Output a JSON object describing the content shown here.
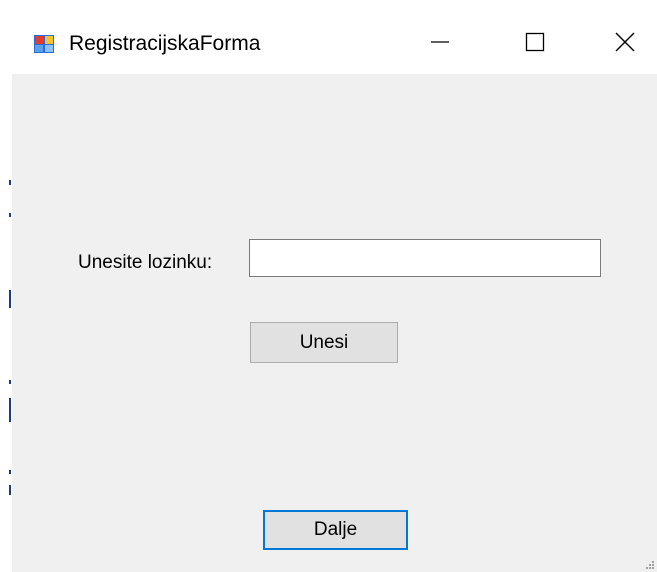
{
  "window": {
    "title": "RegistracijskaForma",
    "icon": "windows-form-icon"
  },
  "controls": {
    "minimize_icon": "minimize-icon",
    "maximize_icon": "maximize-icon",
    "close_icon": "close-icon"
  },
  "form": {
    "password_label": "Unesite lozinku:",
    "password_value": "",
    "submit_label": "Unesi",
    "next_label": "Dalje"
  },
  "colors": {
    "focus_border": "#0078d7",
    "form_background": "#f0f0f0",
    "button_background": "#e1e1e1"
  }
}
